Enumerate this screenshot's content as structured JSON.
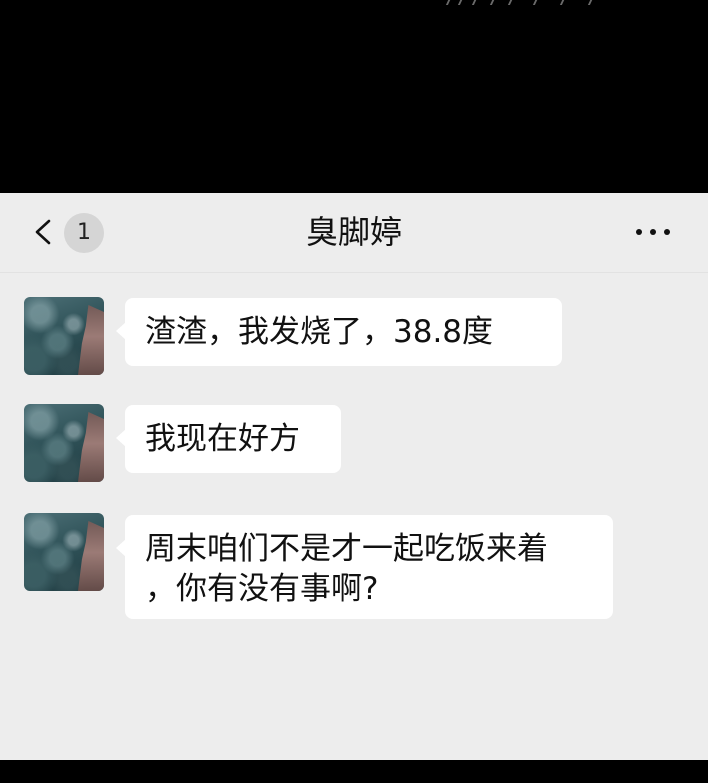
{
  "header": {
    "unread_count": "1",
    "contact_name": "臭脚婷"
  },
  "messages": [
    {
      "lines": [
        "渣渣，我发烧了，38.8度"
      ]
    },
    {
      "lines": [
        "我现在好方"
      ]
    },
    {
      "lines": [
        "周末咱们不是才一起吃饭来着",
        "，你有没有事啊?"
      ]
    }
  ],
  "icons": {
    "back": "chevron-left-icon",
    "more": "more-dots-icon",
    "avatar": "avatar-image"
  },
  "colors": {
    "background": "#ededed",
    "bubble": "#ffffff",
    "badge": "#d5d5d5",
    "letterbox": "#000000"
  }
}
